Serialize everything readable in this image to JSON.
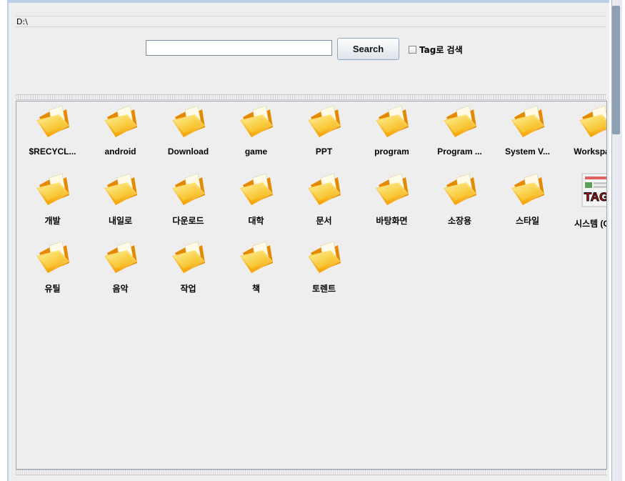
{
  "path": "D:\\",
  "search": {
    "value": "",
    "button_label": "Search"
  },
  "tag_search": {
    "label": "Tag로 검색",
    "checked": false
  },
  "items": [
    {
      "label": "$RECYCL...",
      "icon": "folder-icon"
    },
    {
      "label": "android",
      "icon": "folder-icon"
    },
    {
      "label": "Download",
      "icon": "folder-icon"
    },
    {
      "label": "game",
      "icon": "folder-icon"
    },
    {
      "label": "PPT",
      "icon": "folder-icon"
    },
    {
      "label": "program",
      "icon": "folder-icon"
    },
    {
      "label": "Program ...",
      "icon": "folder-icon"
    },
    {
      "label": "System V...",
      "icon": "folder-icon"
    },
    {
      "label": "Workspa...",
      "icon": "folder-icon"
    },
    {
      "label": "개발",
      "icon": "folder-icon"
    },
    {
      "label": "내일로",
      "icon": "folder-icon"
    },
    {
      "label": "다운로드",
      "icon": "folder-icon"
    },
    {
      "label": "대학",
      "icon": "folder-icon"
    },
    {
      "label": "문서",
      "icon": "folder-icon"
    },
    {
      "label": "바탕화면",
      "icon": "folder-icon"
    },
    {
      "label": "소장용",
      "icon": "folder-icon"
    },
    {
      "label": "스타일",
      "icon": "folder-icon"
    },
    {
      "label": "시스템 (C...",
      "icon": "tag-file-icon",
      "icon_text": "TAG"
    },
    {
      "label": "유틸",
      "icon": "folder-icon"
    },
    {
      "label": "음악",
      "icon": "folder-icon"
    },
    {
      "label": "작업",
      "icon": "folder-icon"
    },
    {
      "label": "책",
      "icon": "folder-icon"
    },
    {
      "label": "토렌트",
      "icon": "folder-icon"
    }
  ]
}
